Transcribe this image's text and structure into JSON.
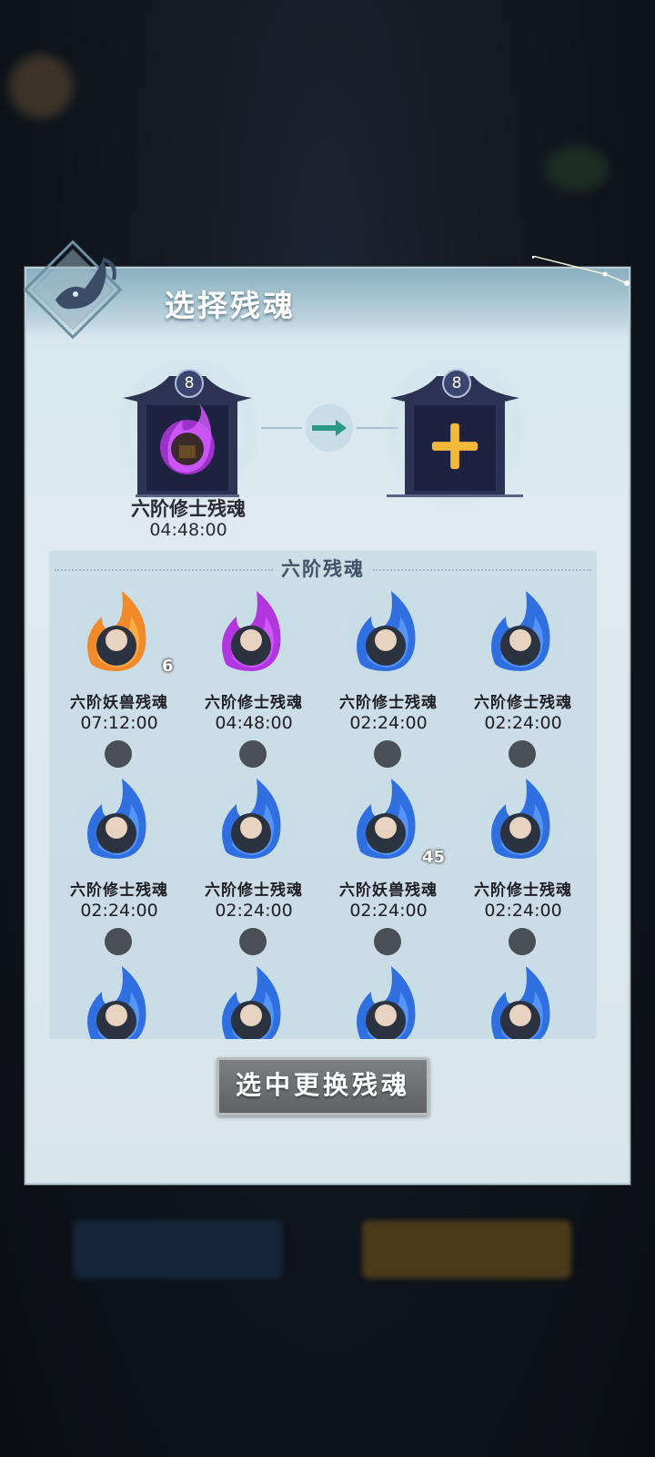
{
  "panel": {
    "title": "选择残魂",
    "source_slot": {
      "level": "8",
      "name": "六阶修士残魂",
      "time": "04:48:00"
    },
    "target_slot": {
      "level": "8"
    },
    "list_title": "六阶残魂",
    "items": [
      {
        "name": "六阶妖兽残魂",
        "time": "07:12:00",
        "count": "6",
        "flame": "orange"
      },
      {
        "name": "六阶修士残魂",
        "time": "04:48:00",
        "count": "",
        "flame": "purple"
      },
      {
        "name": "六阶修士残魂",
        "time": "02:24:00",
        "count": "",
        "flame": "blue"
      },
      {
        "name": "六阶修士残魂",
        "time": "02:24:00",
        "count": "",
        "flame": "blue"
      },
      {
        "name": "六阶修士残魂",
        "time": "02:24:00",
        "count": "",
        "flame": "blue"
      },
      {
        "name": "六阶修士残魂",
        "time": "02:24:00",
        "count": "",
        "flame": "blue"
      },
      {
        "name": "六阶妖兽残魂",
        "time": "02:24:00",
        "count": "45",
        "flame": "blue"
      },
      {
        "name": "六阶修士残魂",
        "time": "02:24:00",
        "count": "",
        "flame": "blue"
      },
      {
        "name": "",
        "time": "",
        "count": "",
        "flame": "blue"
      },
      {
        "name": "",
        "time": "",
        "count": "",
        "flame": "blue"
      },
      {
        "name": "",
        "time": "",
        "count": "",
        "flame": "blue"
      },
      {
        "name": "",
        "time": "",
        "count": "",
        "flame": "blue"
      }
    ],
    "confirm_label": "选中更换残魂"
  },
  "colors": {
    "flame_orange": "#f08a2a",
    "flame_purple": "#b236e0",
    "flame_blue": "#2f6fe0",
    "plus": "#f5b93a",
    "arrow": "#2a9a86"
  }
}
